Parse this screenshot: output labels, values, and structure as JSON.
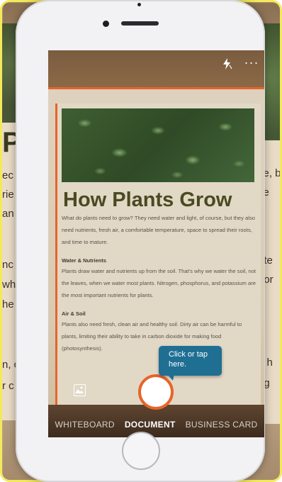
{
  "background": {
    "fragments_left": [
      "P",
      "ec",
      "rie",
      "an",
      "nc",
      "wh",
      "he",
      "n, c",
      "r c"
    ],
    "fragments_right": [
      "se, b",
      "ce",
      "ate",
      "nor",
      "e h",
      "ng"
    ]
  },
  "camera": {
    "flash_icon": "flash-off-icon",
    "more_icon": "more-icon",
    "more_glyph": "···",
    "modes": [
      {
        "label": "WHITEBOARD",
        "active": false
      },
      {
        "label": "DOCUMENT",
        "active": true
      },
      {
        "label": "BUSINESS CARD",
        "active": false
      }
    ],
    "tooltip": "Click or tap here.",
    "accent_color": "#e8642a",
    "tooltip_color": "#1f6f93"
  },
  "document": {
    "title": "How Plants Grow",
    "intro": "What do plants need to grow? They need water and light, of course, but they also need nutrients, fresh air, a comfortable temperature, space to spread their roots, and time to mature.",
    "section1_heading": "Water & Nutrients",
    "section1_text": "Plants draw water and nutrients up from the soil. That's why we water the soil, not the leaves, when we water most plants. Nitrogen, phosphorus, and potassium are the most important nutrients for plants.",
    "section2_heading": "Air & Soil",
    "section2_text": "Plants also need fresh, clean air and healthy soil. Dirty air can be harmful to plants, limiting their ability to take in carbon dioxide for making food (photosynthesis)."
  }
}
